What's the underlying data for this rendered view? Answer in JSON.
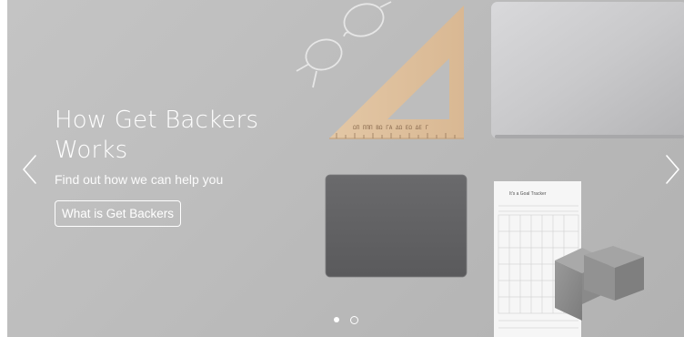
{
  "hero": {
    "title": "How Get Backers Works",
    "subtitle": "Find out how we can help you",
    "cta_label": "What is Get Backers",
    "active_slide": 1,
    "slide_count": 2
  },
  "props": {
    "ruler_marks": "ΩΠ ΠΠΠ ΒΩ ΓΑ ΔΩ ΕΩ ΔΕ Γ",
    "sheet_title": "It's a Goal Tracker"
  },
  "colors": {
    "background": "#bcbcbc",
    "text": "#ffffff"
  },
  "icons": {
    "prev": "chevron-left-icon",
    "next": "chevron-right-icon"
  }
}
